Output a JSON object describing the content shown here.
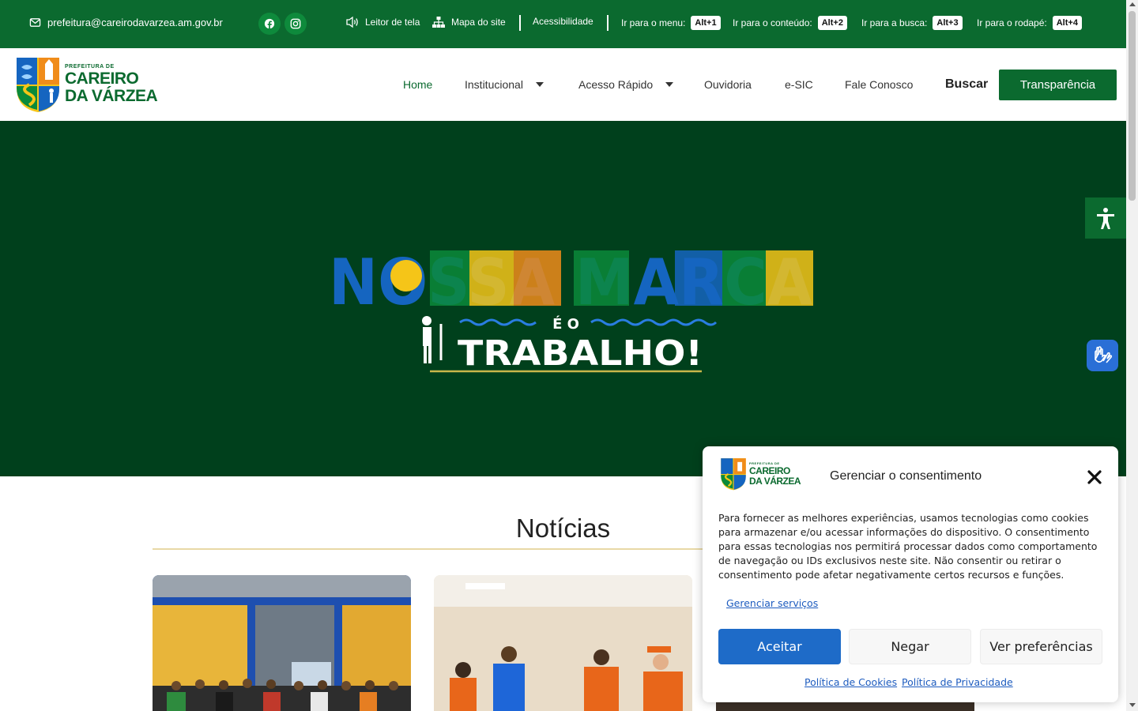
{
  "topbar": {
    "email": "prefeitura@careirodavarzea.am.gov.br",
    "social": [
      {
        "icon": "facebook-icon"
      },
      {
        "icon": "instagram-icon"
      }
    ],
    "accessibility": {
      "screen_reader": "Leitor de tela",
      "sitemap": "Mapa do site",
      "accessibility": "Acessibilidade",
      "shortcuts": [
        {
          "label": "Ir para o menu:",
          "key": "Alt+1"
        },
        {
          "label": "Ir para o conteúdo:",
          "key": "Alt+2"
        },
        {
          "label": "Ir para a busca:",
          "key": "Alt+3"
        },
        {
          "label": "Ir para o rodapé:",
          "key": "Alt+4"
        }
      ]
    }
  },
  "header": {
    "logo": {
      "line1": "PREFEITURA DE",
      "line2": "CAREIRO",
      "line3": "DA VÁRZEA"
    },
    "nav": [
      {
        "label": "Home",
        "active": true
      },
      {
        "label": "Institucional",
        "dropdown": true
      },
      {
        "label": "Acesso Rápido",
        "dropdown": true
      },
      {
        "label": "Ouvidoria"
      },
      {
        "label": "e-SIC"
      },
      {
        "label": "Fale Conosco"
      }
    ],
    "search_label": "Buscar",
    "transparency_label": "Transparência"
  },
  "hero": {
    "title": "NOSSA MARCA",
    "subtitle_small": "É O",
    "subtitle_big": "TRABALHO!",
    "colors": {
      "bg": "#00401c",
      "blue": "#1565c0",
      "green": "#0b8a3a",
      "yellow": "#f5c518",
      "orange": "#f08c1a"
    }
  },
  "news": {
    "title": "Notícias"
  },
  "consent": {
    "logo": {
      "line1": "PREFEITURA DE",
      "line2": "CAREIRO",
      "line3": "DA VÁRZEA"
    },
    "title": "Gerenciar o consentimento",
    "body": "Para fornecer as melhores experiências, usamos tecnologias como cookies para armazenar e/ou acessar informações do dispositivo. O consentimento para essas tecnologias nos permitirá processar dados como comportamento de navegação ou IDs exclusivos neste site. Não consentir ou retirar o consentimento pode afetar negativamente certos recursos e funções.",
    "manage_services": "Gerenciar serviços",
    "accept": "Aceitar",
    "deny": "Negar",
    "preferences": "Ver preferências",
    "cookie_policy": "Política de Cookies",
    "privacy_policy": "Política de Privacidade"
  },
  "colors": {
    "brand_green": "#0b6a2f",
    "accent_blue": "#1e6bc8"
  }
}
